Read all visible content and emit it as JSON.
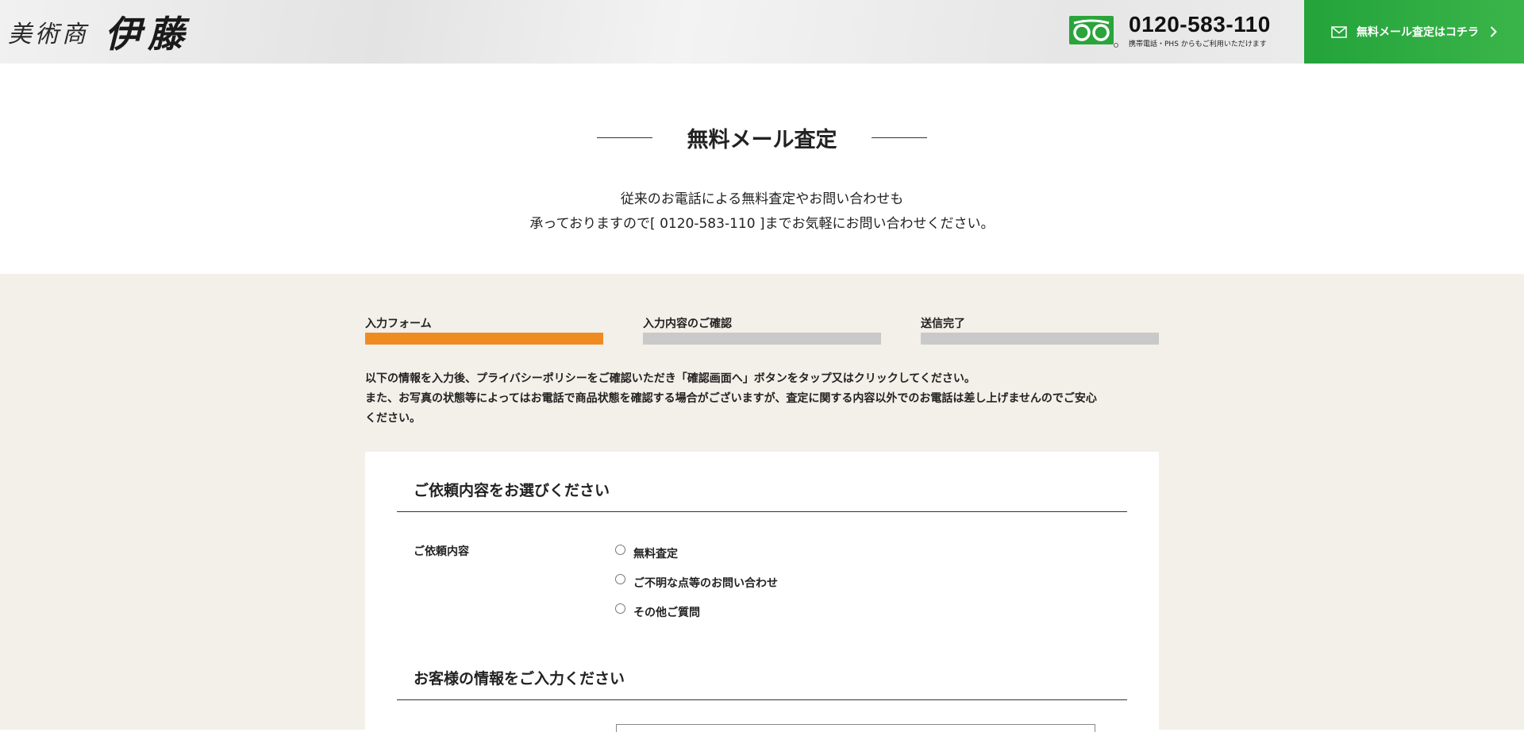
{
  "header": {
    "logo_small": "美術商",
    "logo_big": "伊藤",
    "phone_number": "0120-583-110",
    "phone_note": "携帯電話・PHS からもご利用いただけます",
    "mail_button_label": "無料メール査定はコチラ",
    "accent_color": "#3ab54a"
  },
  "page": {
    "title": "無料メール査定",
    "intro_line1": "従来のお電話による無料査定やお問い合わせも",
    "intro_line2": "承っておりますので[ 0120-583-110 ]までお気軽にお問い合わせください。"
  },
  "steps": [
    {
      "label": "入力フォーム",
      "active": true
    },
    {
      "label": "入力内容のご確認",
      "active": false
    },
    {
      "label": "送信完了",
      "active": false
    }
  ],
  "step_colors": {
    "active": "#f08b22",
    "inactive": "#c9c9c9"
  },
  "notice": {
    "line1": "以下の情報を入力後、プライバシーポリシーをご確認いただき「確認画面へ」ボタンをタップ又はクリックしてください。",
    "line2": "また、お写真の状態等によってはお電話で商品状態を確認する場合がございますが、査定に関する内容以外でのお電話は差し上げませんのでご安心",
    "line3": "ください。"
  },
  "form": {
    "section1_title": "ご依頼内容をお選びください",
    "request_label": "ご依頼内容",
    "options": [
      "無料査定",
      "ご不明な点等のお問い合わせ",
      "その他ご質問"
    ],
    "section2_title": "お客様の情報をご入力ください"
  }
}
